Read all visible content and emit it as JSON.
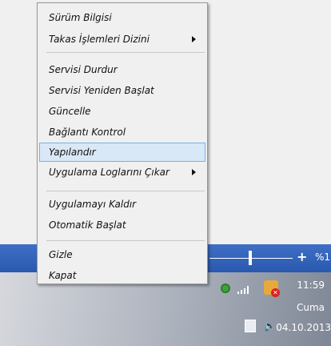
{
  "context_menu": {
    "items": [
      {
        "label": "Sürüm Bilgisi"
      },
      {
        "label": "Takas İşlemleri Dizini",
        "submenu": true
      },
      {
        "label": "Servisi Durdur"
      },
      {
        "label": "Servisi Yeniden Başlat"
      },
      {
        "label": "Güncelle"
      },
      {
        "label": "Bağlantı Kontrol"
      },
      {
        "label": "Yapılandır",
        "highlighted": true
      },
      {
        "label": "Uygulama Loglarını Çıkar",
        "submenu": true
      },
      {
        "label": "Uygulamayı Kaldır"
      },
      {
        "label": "Otomatik Başlat"
      },
      {
        "label": "Gizle"
      },
      {
        "label": "Kapat"
      }
    ]
  },
  "zoom": {
    "plus": "+",
    "level": "%1"
  },
  "clock": {
    "time": "11:59",
    "day": "Cuma",
    "date": "04.10.2013"
  },
  "tray_icons": [
    "battery-icon",
    "signal-icon",
    "network-warning-icon",
    "clipboard-icon",
    "speaker-icon"
  ],
  "colors": {
    "statusbar": "#2f60b8",
    "highlight_bg": "#d9e8f7",
    "highlight_border": "#7ab0e6"
  }
}
